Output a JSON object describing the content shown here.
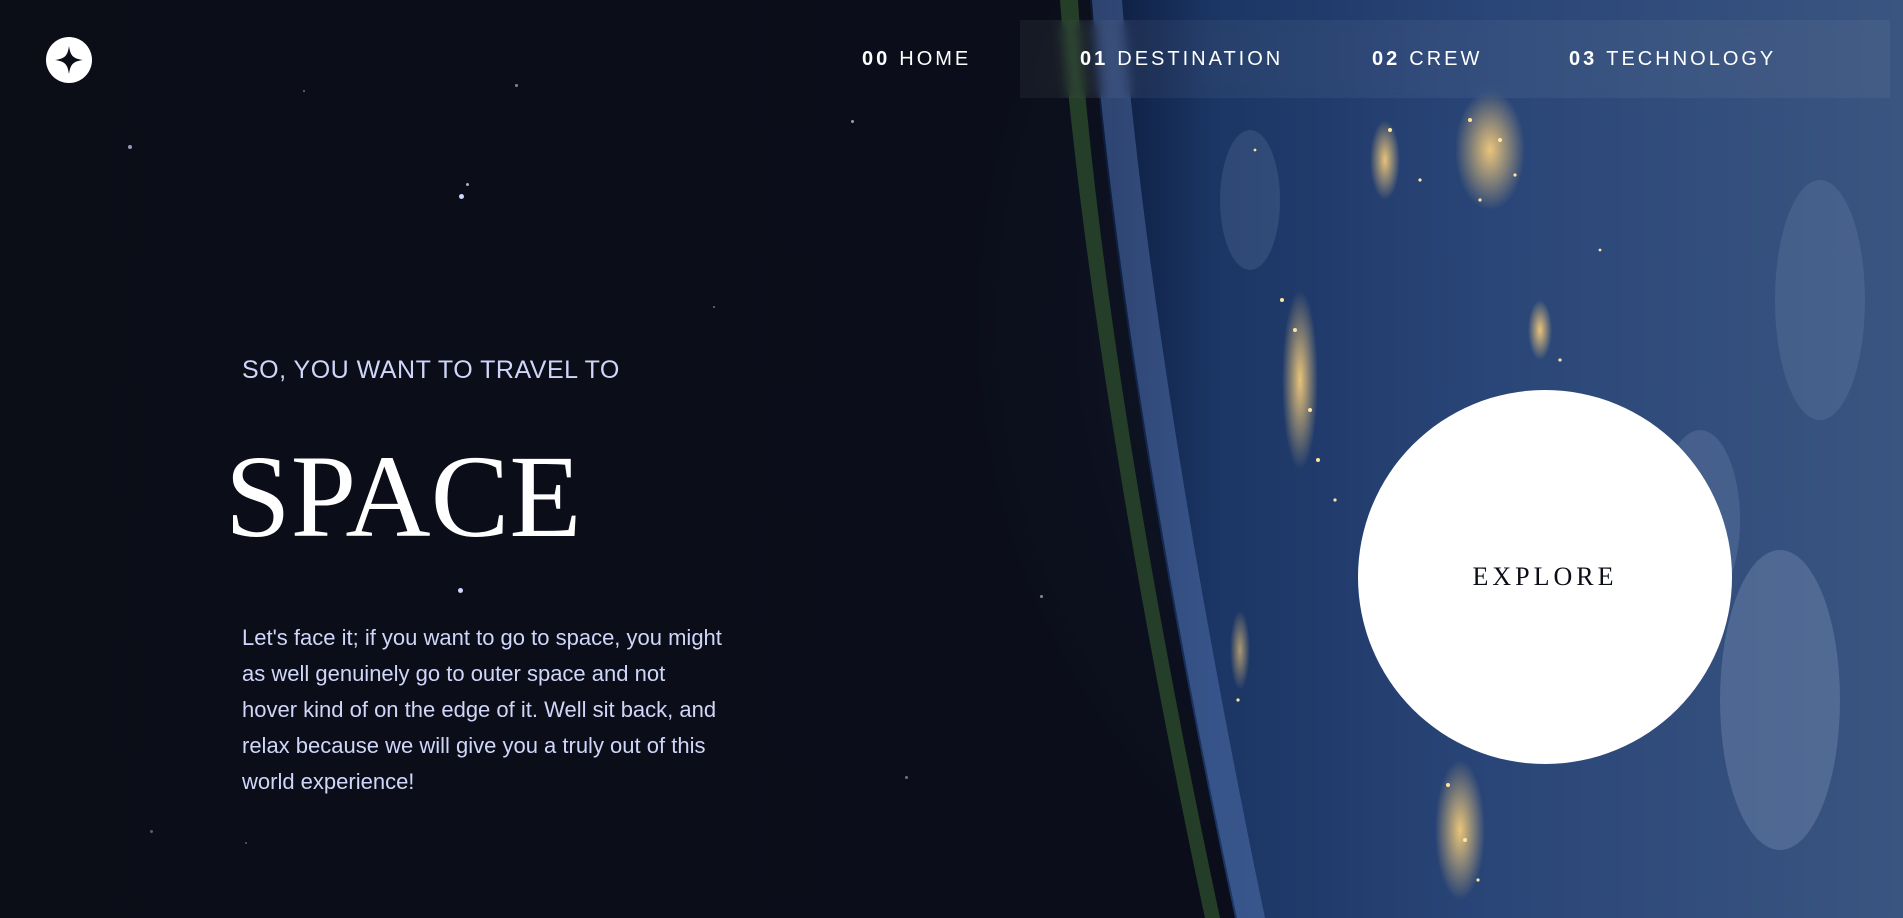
{
  "nav": {
    "items": [
      {
        "num": "00",
        "label": "HOME"
      },
      {
        "num": "01",
        "label": "DESTINATION"
      },
      {
        "num": "02",
        "label": "CREW"
      },
      {
        "num": "03",
        "label": "TECHNOLOGY"
      }
    ]
  },
  "hero": {
    "eyebrow": "SO, YOU WANT TO TRAVEL TO",
    "title": "SPACE",
    "body": "Let's face it; if you want to go to space, you might as well genuinely go to outer space and not hover kind of on the edge of it. Well sit back, and relax because we will give you a truly out of this world experience!"
  },
  "explore": {
    "label": "EXPLORE"
  },
  "icons": {
    "logo": "star-logo-icon"
  },
  "colors": {
    "background": "#0b0d17",
    "accent": "#d0d6f9",
    "white": "#ffffff"
  }
}
